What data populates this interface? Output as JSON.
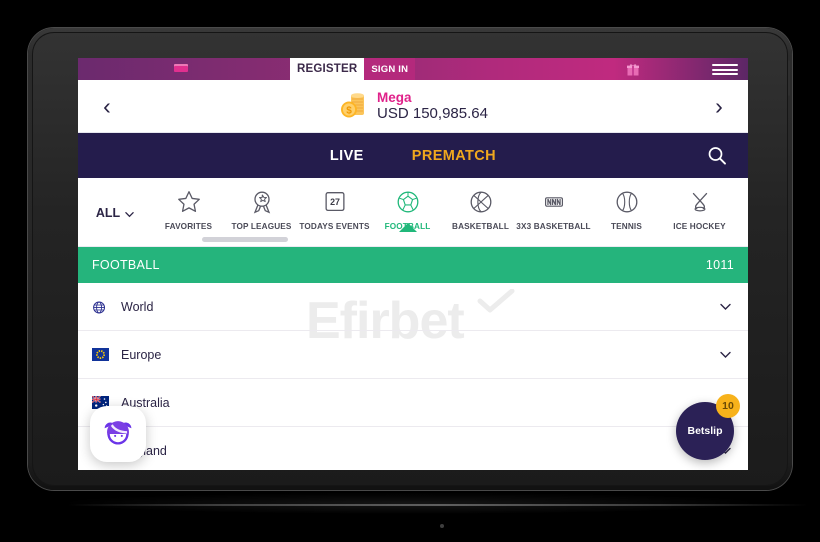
{
  "device": {
    "kind": "tablet",
    "camera": "front-camera"
  },
  "topbar": {
    "logo": "brand-logo",
    "register_label": "REGISTER",
    "signin_label": "SIGN IN",
    "gift_icon": "gift-icon",
    "menu_icon": "hamburger-menu-icon",
    "gradient_start": "#6b2a6e",
    "gradient_end": "#c02a7f"
  },
  "balance": {
    "prev_icon": "chevron-left-icon",
    "next_icon": "chevron-right-icon",
    "coin_icon": "coin-stack-icon",
    "account_name": "Mega",
    "amount": "USD 150,985.64",
    "name_color": "#e0218a"
  },
  "nav": {
    "live_label": "LIVE",
    "prematch_label": "PREMATCH",
    "active": "PREMATCH",
    "active_color": "#f0a81e",
    "background": "#241c4c",
    "search_icon": "search-icon"
  },
  "sports": {
    "all_label": "ALL",
    "all_caret": "chevron-down-icon",
    "active": "FOOTBALL",
    "active_color": "#20b87a",
    "items": [
      {
        "label": "FAVORITES",
        "icon": "star-icon"
      },
      {
        "label": "TOP LEAGUES",
        "icon": "award-rosette-icon"
      },
      {
        "label": "TODAYS EVENTS",
        "icon": "calendar-icon",
        "badge": "27"
      },
      {
        "label": "FOOTBALL",
        "icon": "football-icon"
      },
      {
        "label": "BASKETBALL",
        "icon": "basketball-icon"
      },
      {
        "label": "3X3 BASKETBALL",
        "icon": "3x3-basketball-icon"
      },
      {
        "label": "TENNIS",
        "icon": "tennis-ball-icon"
      },
      {
        "label": "ICE HOCKEY",
        "icon": "ice-hockey-icon"
      }
    ]
  },
  "sport_header": {
    "title": "FOOTBALL",
    "count": "1011",
    "background": "#25b47c"
  },
  "regions": [
    {
      "name": "World",
      "flag": "globe-icon",
      "expand": "chevron-down-icon"
    },
    {
      "name": "Europe",
      "flag": "european-union-flag",
      "expand": "chevron-down-icon"
    },
    {
      "name": "Australia",
      "flag": "australia-flag",
      "expand": "chevron-down-icon"
    },
    {
      "name": "England",
      "flag": "england-flag",
      "expand": "chevron-down-icon"
    }
  ],
  "watermark": {
    "text": "Efirbet"
  },
  "widgets": {
    "chat_icon": "chat-avatar-icon",
    "betslip_label": "Betslip",
    "betslip_count": "10",
    "betslip_color": "#2b2156",
    "badge_color": "#f7b21b"
  }
}
